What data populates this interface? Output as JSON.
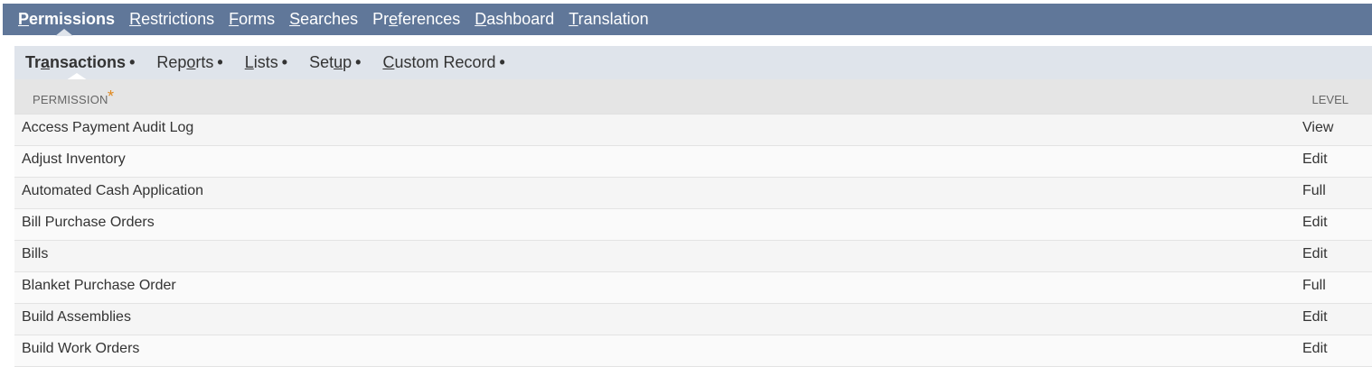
{
  "top_tabs": [
    {
      "key": "P",
      "rest": "ermissions",
      "pre": "",
      "active": true
    },
    {
      "key": "R",
      "rest": "estrictions",
      "pre": "",
      "active": false
    },
    {
      "key": "F",
      "rest": "orms",
      "pre": "",
      "active": false
    },
    {
      "key": "S",
      "rest": "earches",
      "pre": "",
      "active": false
    },
    {
      "key": "e",
      "rest": "ferences",
      "pre": "Pr",
      "active": false
    },
    {
      "key": "D",
      "rest": "ashboard",
      "pre": "",
      "active": false
    },
    {
      "key": "T",
      "rest": "ranslation",
      "pre": "",
      "active": false
    }
  ],
  "sub_tabs": [
    {
      "pre": "Tr",
      "key": "a",
      "rest": "nsactions",
      "dot": "•",
      "active": true
    },
    {
      "pre": "Rep",
      "key": "o",
      "rest": "rts",
      "dot": "•",
      "active": false
    },
    {
      "pre": "",
      "key": "L",
      "rest": "ists",
      "dot": "•",
      "active": false
    },
    {
      "pre": "Set",
      "key": "u",
      "rest": "p",
      "dot": "•",
      "active": false
    },
    {
      "pre": "",
      "key": "C",
      "rest": "ustom Record",
      "dot": "•",
      "active": false
    }
  ],
  "grid": {
    "header_permission": "PERMISSION",
    "header_star": "*",
    "header_level": "LEVEL",
    "rows": [
      {
        "permission": "Access Payment Audit Log",
        "level": "View"
      },
      {
        "permission": "Adjust Inventory",
        "level": "Edit"
      },
      {
        "permission": "Automated Cash Application",
        "level": "Full"
      },
      {
        "permission": "Bill Purchase Orders",
        "level": "Edit"
      },
      {
        "permission": "Bills",
        "level": "Edit"
      },
      {
        "permission": "Blanket Purchase Order",
        "level": "Full"
      },
      {
        "permission": "Build Assemblies",
        "level": "Edit"
      },
      {
        "permission": "Build Work Orders",
        "level": "Edit"
      }
    ]
  }
}
